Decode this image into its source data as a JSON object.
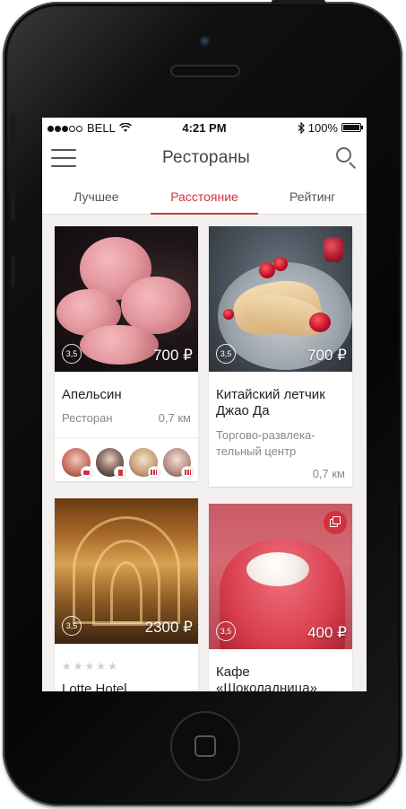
{
  "status_bar": {
    "carrier": "BELL",
    "time": "4:21 PM",
    "battery": "100%"
  },
  "nav": {
    "title": "Рестораны"
  },
  "tabs": [
    {
      "label": "Лучшее",
      "active": false
    },
    {
      "label": "Расстояние",
      "active": true
    },
    {
      "label": "Рейтинг",
      "active": false
    }
  ],
  "cards": [
    {
      "name": "Апельсин",
      "type": "Ресторан",
      "distance": "0,7 км",
      "price": "700 ₽",
      "rating": "3,5",
      "friends": [
        {
          "avatar_icon": "user-avatar-icon",
          "badge_icon": "comment-icon"
        },
        {
          "avatar_icon": "user-avatar-icon",
          "badge_icon": "bookmark-icon"
        },
        {
          "avatar_icon": "user-avatar-icon",
          "badge_icon": "rating-bars-icon"
        },
        {
          "avatar_icon": "user-avatar-icon",
          "badge_icon": "rating-bars-icon"
        }
      ]
    },
    {
      "name": "Китайский летчик Джао Да",
      "type": "Торгово-развлека-тельный центр",
      "distance": "0,7 км",
      "price": "700 ₽",
      "rating": "3,5"
    },
    {
      "name": "Lotte Hotel",
      "price": "2300 ₽",
      "rating": "3,5",
      "stars_filled": 0,
      "stars_total": 5
    },
    {
      "name": "Кафе «Шоколадница»",
      "price": "400 ₽",
      "rating": "3,5",
      "badge_icon": "copy-icon"
    }
  ],
  "colors": {
    "accent": "#d0333e",
    "background": "#f3f1f0"
  }
}
